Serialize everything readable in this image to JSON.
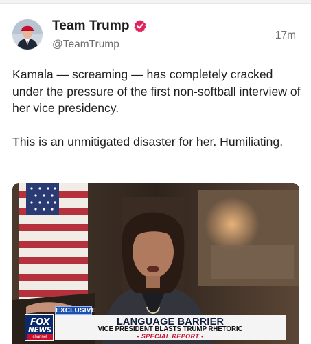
{
  "post": {
    "author": {
      "display_name": "Team Trump",
      "handle": "@TeamTrump",
      "verified_icon": "verified-badge-icon",
      "avatar_icon": "avatar-photo"
    },
    "timestamp": "17m",
    "paragraphs": [
      "Kamala — screaming — has completely cracked under the pressure of the first non-softball interview of her vice presidency.",
      "This is an unmitigated disaster for her. Humiliating."
    ],
    "media": {
      "chyron": {
        "network_logo_top": "FOX",
        "network_logo_middle": "NEWS",
        "network_logo_bottom": "channel",
        "tag": "EXCLUSIVE",
        "headline": "LANGUAGE BARRIER",
        "subheadline": "VICE PRESIDENT BLASTS TRUMP RHETORIC",
        "report": "• SPECIAL REPORT •"
      }
    }
  },
  "colors": {
    "verified": "#e0245e",
    "fox_blue": "#0b2a6b",
    "fox_red": "#c8102e",
    "text_primary": "#1f1f22",
    "text_secondary": "#6e6e73"
  }
}
